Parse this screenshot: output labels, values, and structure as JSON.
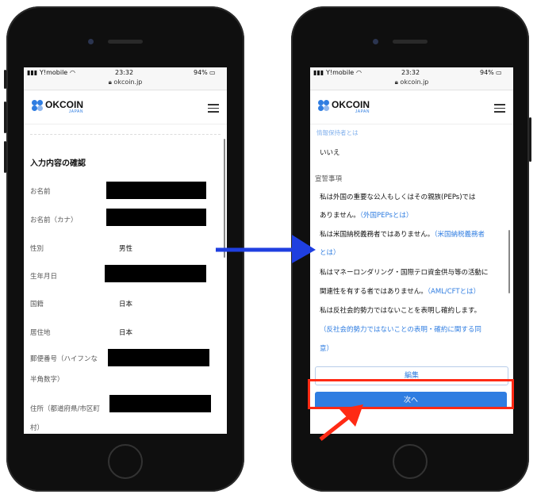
{
  "status": {
    "carrier": "Y!mobile",
    "time": "23:32",
    "battery": "94%"
  },
  "url": "okcoin.jp",
  "brand": {
    "name": "OKCOIN",
    "sub": "JAPAN"
  },
  "left": {
    "section_title": "入力内容の確認",
    "rows": [
      {
        "label": "お名前",
        "value": ""
      },
      {
        "label": "お名前（カナ）",
        "value": ""
      },
      {
        "label": "性別",
        "value": "男性"
      },
      {
        "label": "生年月日",
        "value": ""
      },
      {
        "label": "国籍",
        "value": "日本"
      },
      {
        "label": "居住地",
        "value": "日本"
      },
      {
        "label_line1": "郵便番号（ハイフンな",
        "label_line2": "半角数字）"
      },
      {
        "label_line1": "住所（都道府県/市区町",
        "label_line2": "村）"
      }
    ]
  },
  "right": {
    "top_partial": "情報保持者とは",
    "answer": "いいえ",
    "declaration_title": "宣誓事項",
    "pep_line1": "私は外国の重要な公人もしくはその親族(PEPs)では",
    "pep_line2": "ありません。",
    "pep_link": "（外国PEPsとは）",
    "us_text": "私は米国納税義務者ではありません。",
    "us_link1": "（米国納税義務者",
    "us_link2": "とは）",
    "aml_line1": "私はマネーロンダリング・国際テロ資金供与等の活動に",
    "aml_line2": "関連性を有する者ではありません。",
    "aml_link": "（AML/CFTとは）",
    "anti_text": "私は反社会的勢力ではないことを表明し確約します。",
    "anti_link1": "（反社会的勢力ではないことの表明・確約に関する同",
    "anti_link2": "意）",
    "edit_button": "編集",
    "next_button": "次へ"
  },
  "colors": {
    "accent": "#2f7de1",
    "arrow": "#1f3fe0",
    "highlight": "#ff2a14"
  }
}
